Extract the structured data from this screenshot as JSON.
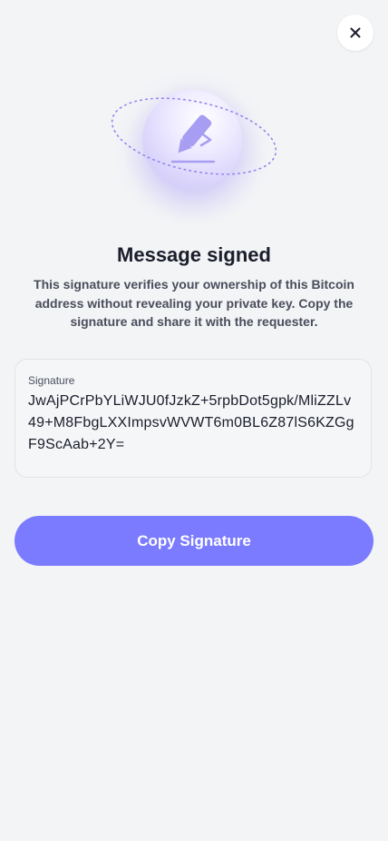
{
  "close_button": {
    "icon": "close-icon"
  },
  "hero": {
    "icon": "pen-signature-icon",
    "accent": "#7b7bff"
  },
  "title": "Message signed",
  "description": "This signature verifies your ownership of this Bitcoin address without revealing your private key. Copy the signature and share it with the requester.",
  "signature": {
    "label": "Signature",
    "value": "JwAjPCrPbYLiWJU0fJzkZ+5rpbDot5gpk/MliZZLv49+M8FbgLXXImpsvWVWT6m0BL6Z87lS6KZGgF9ScAab+2Y="
  },
  "copy_button": {
    "label": "Copy Signature",
    "color": "#7b7bff"
  }
}
